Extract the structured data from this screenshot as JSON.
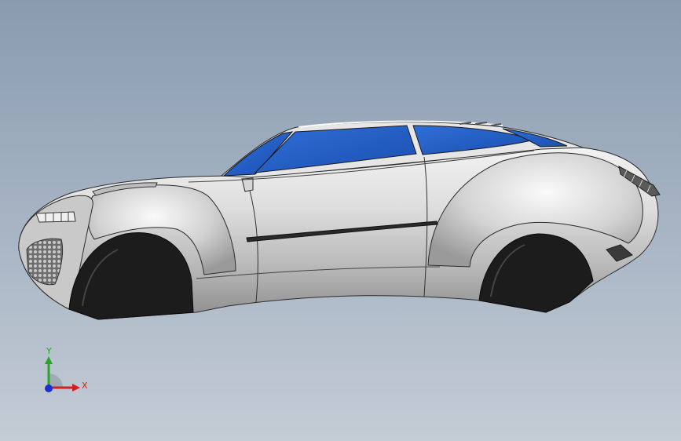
{
  "viewport": {
    "background_top": "#8a9bb0",
    "background_bottom": "#c4ccd6"
  },
  "model": {
    "body_color": "#d9d9d9",
    "glass_color": "#1f5ec7",
    "tire_color": "#1c1c1c"
  },
  "triad": {
    "y_label": "Y",
    "x_label": "X",
    "y_color": "#2aa52a",
    "x_color": "#d42020",
    "z_color": "#1c2fd0"
  }
}
